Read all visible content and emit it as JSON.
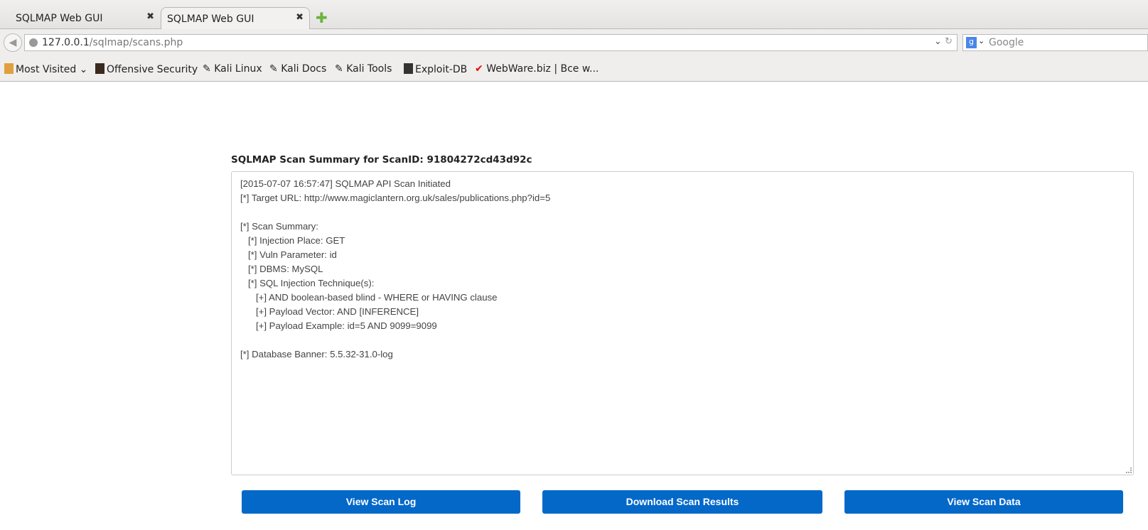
{
  "browser": {
    "tabs": [
      {
        "label": "SQLMAP Web GUI"
      },
      {
        "label": "SQLMAP Web GUI"
      }
    ],
    "url_host": "127.0.0.1",
    "url_path": "/sqlmap/scans.php",
    "search_placeholder": "Google",
    "bookmarks": [
      {
        "label": "Most Visited",
        "icon": "folder-icon"
      },
      {
        "label": "Offensive Security",
        "icon": "offsec-icon"
      },
      {
        "label": "Kali Linux",
        "icon": "kali-dragon-icon"
      },
      {
        "label": "Kali Docs",
        "icon": "kali-dragon-icon"
      },
      {
        "label": "Kali Tools",
        "icon": "kali-dragon-icon"
      },
      {
        "label": "Exploit-DB",
        "icon": "exploitdb-icon"
      },
      {
        "label": "WebWare.biz | Все w...",
        "icon": "checkmark-icon"
      }
    ]
  },
  "page": {
    "title": "SQLMAP Scan Summary for ScanID: 91804272cd43d92c",
    "summary_text": "[2015-07-07 16:57:47] SQLMAP API Scan Initiated\n[*] Target URL: http://www.magiclantern.org.uk/sales/publications.php?id=5\n\n[*] Scan Summary:\n   [*] Injection Place: GET\n   [*] Vuln Parameter: id\n   [*] DBMS: MySQL\n   [*] SQL Injection Technique(s):\n      [+] AND boolean-based blind - WHERE or HAVING clause\n      [+] Payload Vector: AND [INFERENCE]\n      [+] Payload Example: id=5 AND 9099=9099\n\n[*] Database Banner: 5.5.32-31.0-log",
    "buttons": {
      "view_log": "View Scan Log",
      "download": "Download Scan Results",
      "view_data": "View Scan Data"
    }
  },
  "colors": {
    "button": "#0468c9"
  }
}
